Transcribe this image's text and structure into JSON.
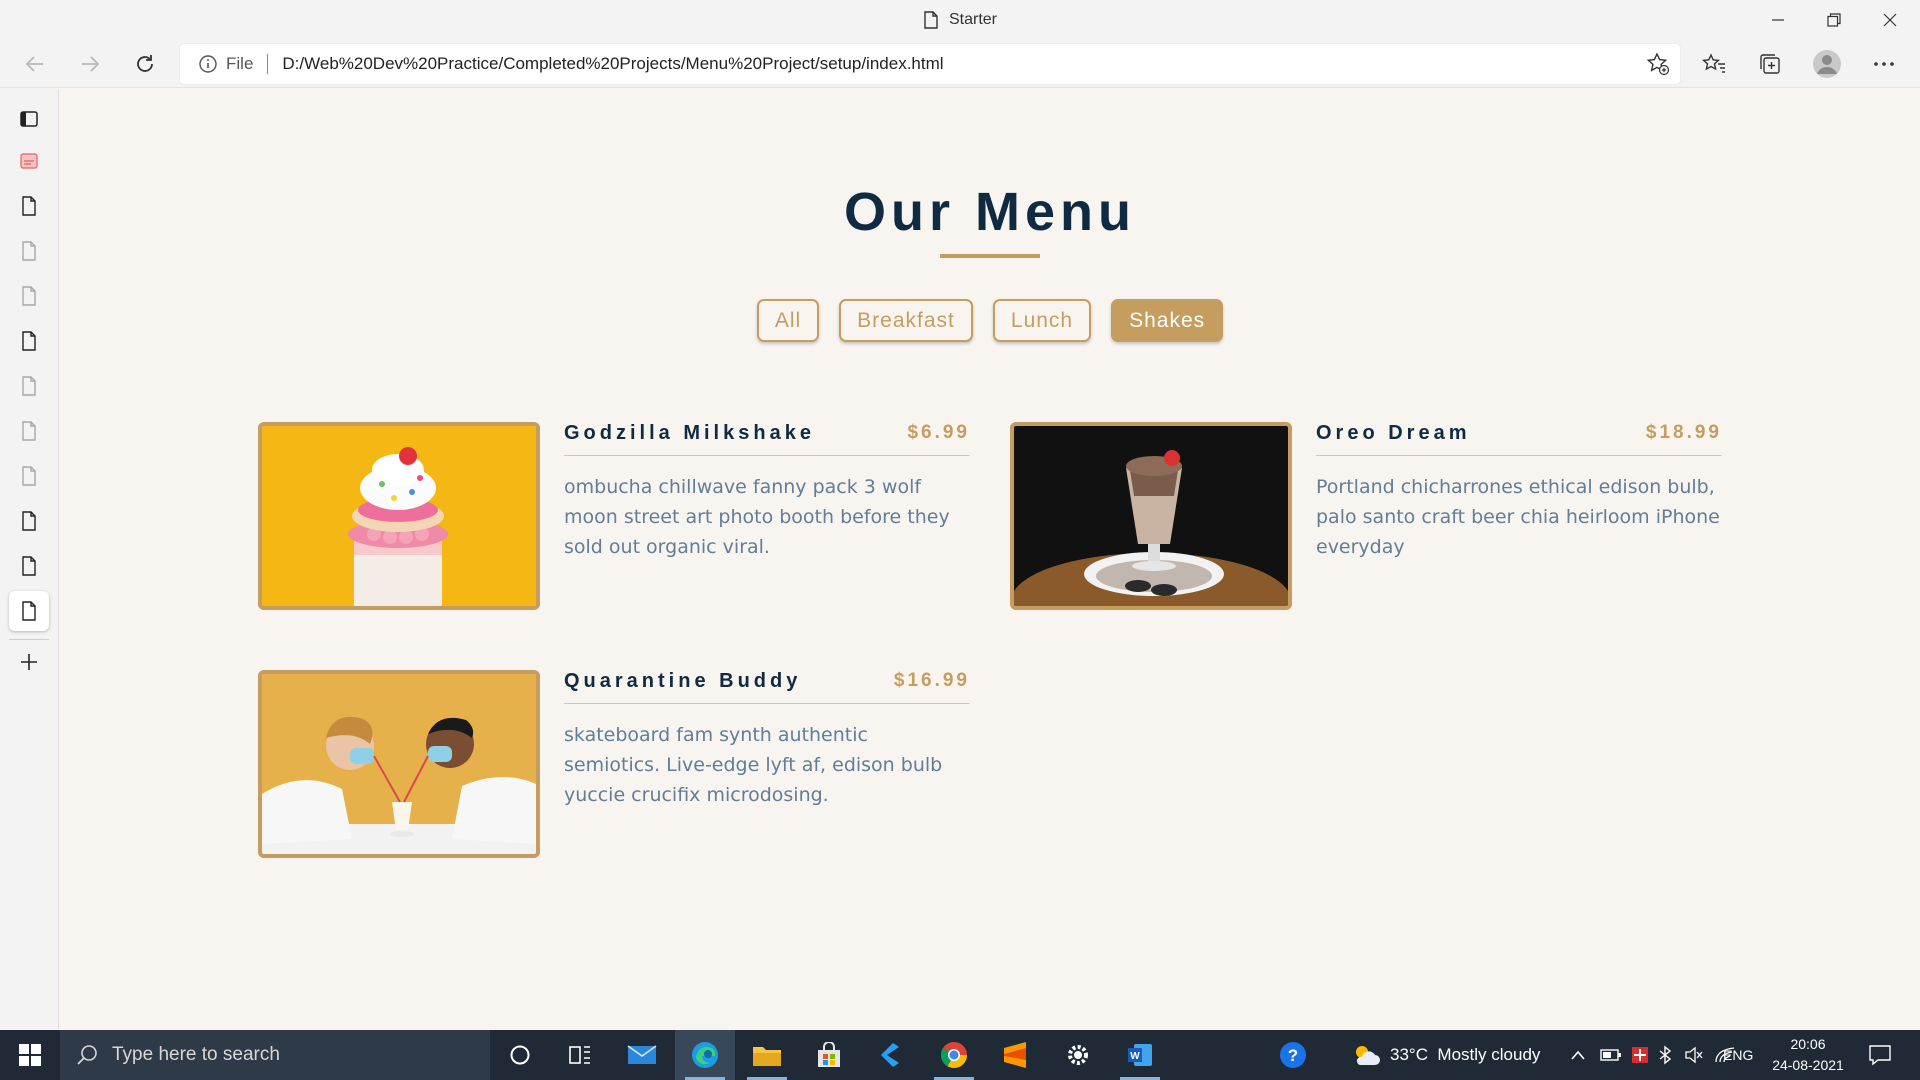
{
  "browser": {
    "window_title": "Starter",
    "address_prefix": "File",
    "url": "D:/Web%20Dev%20Practice/Completed%20Projects/Menu%20Project/setup/index.html"
  },
  "page": {
    "title": "Our Menu",
    "filters": [
      {
        "label": "All",
        "active": false
      },
      {
        "label": "Breakfast",
        "active": false
      },
      {
        "label": "Lunch",
        "active": false
      },
      {
        "label": "Shakes",
        "active": true
      }
    ],
    "items": [
      {
        "name": "Godzilla Milkshake",
        "price": "$6.99",
        "desc": "ombucha chillwave fanny pack 3 wolf moon street art photo booth before they sold out organic viral."
      },
      {
        "name": "Oreo Dream",
        "price": "$18.99",
        "desc": "Portland chicharrones ethical edison bulb, palo santo craft beer chia heirloom iPhone everyday"
      },
      {
        "name": "Quarantine Buddy",
        "price": "$16.99",
        "desc": "skateboard fam synth authentic semiotics. Live-edge lyft af, edison bulb yuccie crucifix microdosing."
      }
    ]
  },
  "taskbar": {
    "search_placeholder": "Type here to search",
    "weather": "33°C  Mostly cloudy",
    "language": "ENG",
    "time": "20:06",
    "date": "24-08-2021"
  },
  "colors": {
    "accent_gold": "#c59d5f",
    "heading_navy": "#102a42",
    "desc_gray": "#617d98",
    "page_bg": "#f8f5f0",
    "taskbar_bg": "#1f2a36"
  }
}
